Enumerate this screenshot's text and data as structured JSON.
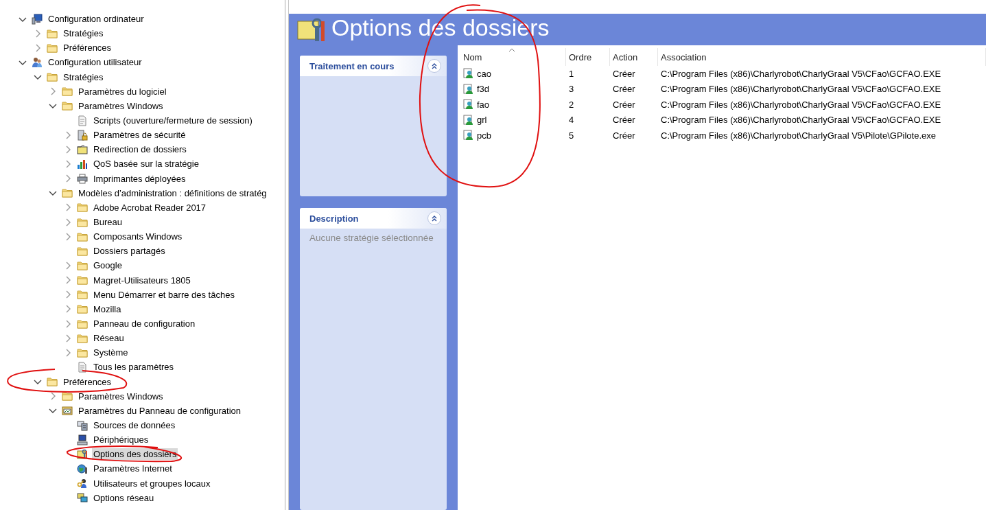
{
  "tree": [
    {
      "label": "Configuration ordinateur",
      "kind": "computer",
      "expanded": true,
      "selected": false,
      "children": [
        {
          "label": "Stratégies",
          "kind": "folder",
          "expanded": false,
          "selected": false
        },
        {
          "label": "Préférences",
          "kind": "folder",
          "expanded": false,
          "selected": false
        }
      ]
    },
    {
      "label": "Configuration utilisateur",
      "kind": "users",
      "expanded": true,
      "selected": false,
      "children": [
        {
          "label": "Stratégies",
          "kind": "folder",
          "expanded": true,
          "selected": false,
          "children": [
            {
              "label": "Paramètres du logiciel",
              "kind": "folder",
              "expanded": false,
              "selected": false
            },
            {
              "label": "Paramètres Windows",
              "kind": "folder",
              "expanded": true,
              "selected": false,
              "children": [
                {
                  "label": "Scripts (ouverture/fermeture de session)",
                  "kind": "script",
                  "selected": false
                },
                {
                  "label": "Paramètres de sécurité",
                  "kind": "security",
                  "expanded": false,
                  "selected": false
                },
                {
                  "label": "Redirection de dossiers",
                  "kind": "folder-plain",
                  "expanded": false,
                  "selected": false
                },
                {
                  "label": "QoS basée sur la stratégie",
                  "kind": "chart",
                  "expanded": false,
                  "selected": false
                },
                {
                  "label": "Imprimantes déployées",
                  "kind": "printer",
                  "expanded": false,
                  "selected": false
                }
              ]
            },
            {
              "label": "Modèles d’administration : définitions de stratég",
              "kind": "folder",
              "expanded": true,
              "selected": false,
              "children": [
                {
                  "label": "Adobe Acrobat Reader 2017",
                  "kind": "folder",
                  "expanded": false,
                  "selected": false
                },
                {
                  "label": "Bureau",
                  "kind": "folder",
                  "expanded": false,
                  "selected": false
                },
                {
                  "label": "Composants Windows",
                  "kind": "folder",
                  "expanded": false,
                  "selected": false
                },
                {
                  "label": "Dossiers partagés",
                  "kind": "folder",
                  "selected": false
                },
                {
                  "label": "Google",
                  "kind": "folder",
                  "expanded": false,
                  "selected": false
                },
                {
                  "label": "Magret-Utilisateurs 1805",
                  "kind": "folder",
                  "expanded": false,
                  "selected": false
                },
                {
                  "label": "Menu Démarrer et barre des tâches",
                  "kind": "folder",
                  "expanded": false,
                  "selected": false
                },
                {
                  "label": "Mozilla",
                  "kind": "folder",
                  "expanded": false,
                  "selected": false
                },
                {
                  "label": "Panneau de configuration",
                  "kind": "folder",
                  "expanded": false,
                  "selected": false
                },
                {
                  "label": "Réseau",
                  "kind": "folder",
                  "expanded": false,
                  "selected": false
                },
                {
                  "label": "Système",
                  "kind": "folder",
                  "expanded": false,
                  "selected": false
                },
                {
                  "label": "Tous les paramètres",
                  "kind": "script",
                  "selected": false
                }
              ]
            }
          ]
        },
        {
          "label": "Préférences",
          "kind": "folder",
          "expanded": true,
          "selected": false,
          "children": [
            {
              "label": "Paramètres Windows",
              "kind": "folder",
              "expanded": false,
              "selected": false
            },
            {
              "label": "Paramètres du Panneau de configuration",
              "kind": "control-panel",
              "expanded": true,
              "selected": false,
              "children": [
                {
                  "label": "Sources de données",
                  "kind": "database",
                  "selected": false
                },
                {
                  "label": "Périphériques",
                  "kind": "monitor",
                  "selected": false
                },
                {
                  "label": "Options des dossiers",
                  "kind": "folder-tools",
                  "selected": true
                },
                {
                  "label": "Paramètres Internet",
                  "kind": "globe",
                  "selected": false
                },
                {
                  "label": "Utilisateurs et groupes locaux",
                  "kind": "user-key",
                  "selected": false
                },
                {
                  "label": "Options réseau",
                  "kind": "network",
                  "selected": false
                }
              ]
            }
          ]
        }
      ]
    }
  ],
  "title": "Options des dossiers",
  "panels": [
    {
      "title": "Traitement en cours"
    },
    {
      "title": "Description",
      "body": "Aucune stratégie sélectionnée"
    }
  ],
  "table": {
    "columns": [
      "Nom",
      "Ordre",
      "Action",
      "Association"
    ],
    "rows": [
      [
        "cao",
        "1",
        "Créer",
        "C:\\Program Files (x86)\\Charlyrobot\\CharlyGraal V5\\CFao\\GCFAO.EXE"
      ],
      [
        "f3d",
        "3",
        "Créer",
        "C:\\Program Files (x86)\\Charlyrobot\\CharlyGraal V5\\CFao\\GCFAO.EXE"
      ],
      [
        "fao",
        "2",
        "Créer",
        "C:\\Program Files (x86)\\Charlyrobot\\CharlyGraal V5\\CFao\\GCFAO.EXE"
      ],
      [
        "grl",
        "4",
        "Créer",
        "C:\\Program Files (x86)\\Charlyrobot\\CharlyGraal V5\\CFao\\GCFAO.EXE"
      ],
      [
        "pcb",
        "5",
        "Créer",
        "C:\\Program Files (x86)\\Charlyrobot\\CharlyGraal V5\\Pilote\\GPilote.exe"
      ]
    ]
  }
}
